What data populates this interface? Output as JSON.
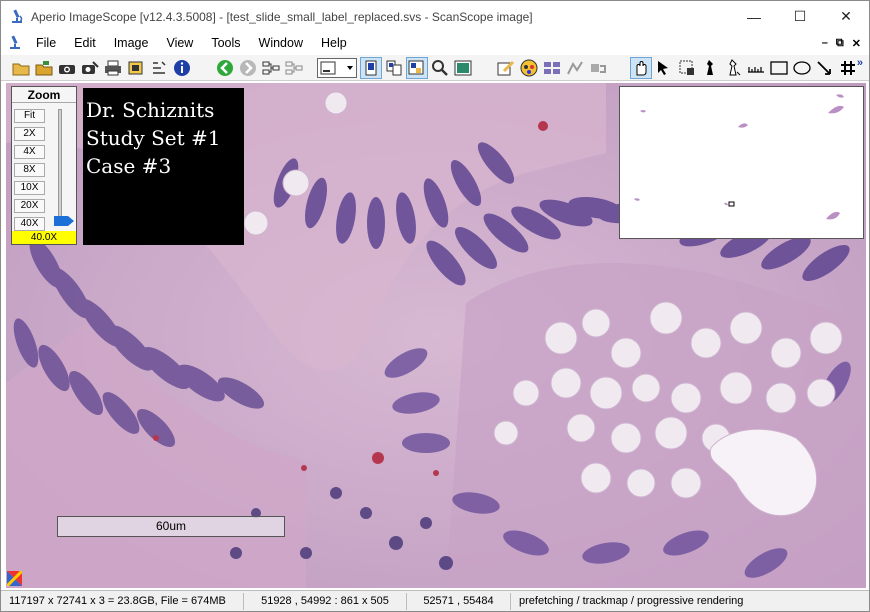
{
  "window": {
    "title": "Aperio ImageScope [v12.4.3.5008] - [test_slide_small_label_replaced.svs - ScanScope image]",
    "controls": {
      "minimize": "—",
      "maximize": "☐",
      "close": "✕"
    }
  },
  "menu": {
    "items": [
      "File",
      "Edit",
      "Image",
      "View",
      "Tools",
      "Window",
      "Help"
    ],
    "mdi": {
      "minimize": "–",
      "restore": "⧉",
      "close": "✕"
    }
  },
  "toolbar": {
    "icons": [
      "open-icon",
      "open-folder-icon",
      "snapshot-icon",
      "extract-icon",
      "print-icon",
      "image-info-icon",
      "properties-icon",
      "info-icon",
      "back-icon",
      "forward-icon",
      "link-icon",
      "sync-icon",
      "view-select-icon",
      "split-view-icon",
      "compare-icon",
      "tile-icon",
      "magnifier-icon",
      "thumbnail-icon",
      "annotation-edit-icon",
      "colors-icon",
      "layers-icon",
      "analysis-icon",
      "algorithm-icon",
      "pan-hand-icon",
      "select-arrow-icon",
      "region-icon",
      "pen-icon",
      "pen-alt-icon",
      "ruler-icon",
      "rectangle-icon",
      "ellipse-icon",
      "arrow-icon",
      "grid-icon"
    ]
  },
  "zoom": {
    "title": "Zoom",
    "buttons": [
      "Fit",
      "2X",
      "4X",
      "8X",
      "10X",
      "20X",
      "40X"
    ],
    "value": "40.0X",
    "level": 1.0
  },
  "label": {
    "lines": [
      "Dr. Schiznits",
      "Study Set #1",
      "Case #3"
    ]
  },
  "scale": {
    "text": "60um"
  },
  "status": {
    "dimensions": "117197 x 72741 x 3 = 23.8GB, File = 674MB",
    "viewport": "51928 , 54992 : 861 x 505",
    "cursor": "52571 , 55484",
    "mode": "prefetching / trackmap / progressive rendering"
  },
  "colors": {
    "tissue_bg": "#c9a9c6",
    "nuclei": "#6a4f95",
    "zoom_value_bg": "#ffff00",
    "label_bg": "#000000"
  }
}
